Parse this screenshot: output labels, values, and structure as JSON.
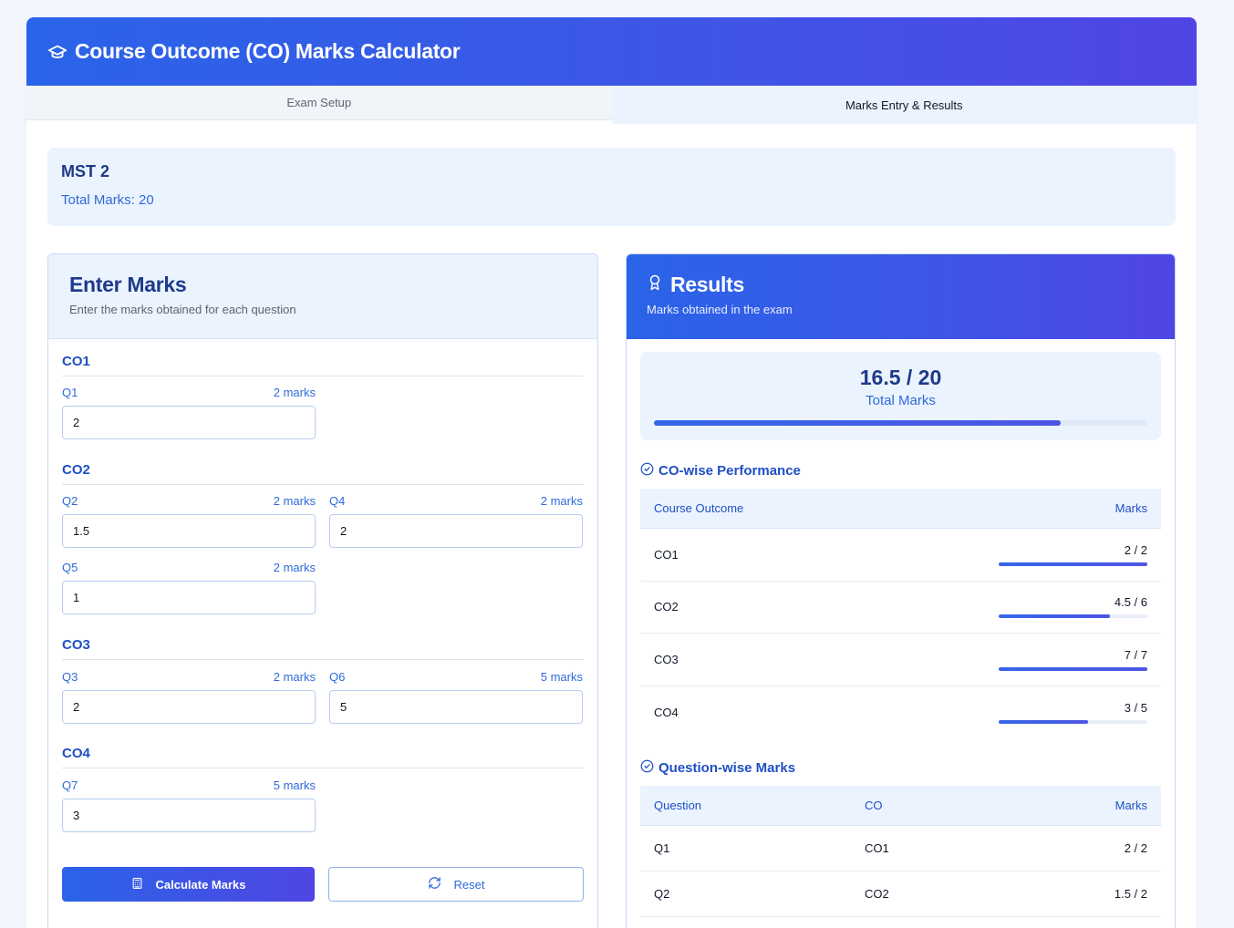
{
  "app": {
    "title": "Course Outcome (CO) Marks Calculator"
  },
  "tabs": [
    {
      "label": "Exam Setup",
      "active": false
    },
    {
      "label": "Marks Entry & Results",
      "active": true
    }
  ],
  "exam": {
    "name": "MST 2",
    "total_label": "Total Marks: 20"
  },
  "entry": {
    "title": "Enter Marks",
    "subtitle": "Enter the marks obtained for each question",
    "groups": [
      {
        "co": "CO1",
        "questions": [
          {
            "q": "Q1",
            "max": "2 marks",
            "value": "2"
          }
        ]
      },
      {
        "co": "CO2",
        "questions": [
          {
            "q": "Q2",
            "max": "2 marks",
            "value": "1.5"
          },
          {
            "q": "Q4",
            "max": "2 marks",
            "value": "2"
          },
          {
            "q": "Q5",
            "max": "2 marks",
            "value": "1"
          }
        ]
      },
      {
        "co": "CO3",
        "questions": [
          {
            "q": "Q3",
            "max": "2 marks",
            "value": "2"
          },
          {
            "q": "Q6",
            "max": "5 marks",
            "value": "5"
          }
        ]
      },
      {
        "co": "CO4",
        "questions": [
          {
            "q": "Q7",
            "max": "5 marks",
            "value": "3"
          }
        ]
      }
    ],
    "calculate_label": "Calculate Marks",
    "reset_label": "Reset"
  },
  "results": {
    "title": "Results",
    "subtitle": "Marks obtained in the exam",
    "score": "16.5 / 20",
    "score_label": "Total Marks",
    "score_fraction": 0.825,
    "co_section_title": "CO-wise Performance",
    "co_headers": {
      "outcome": "Course Outcome",
      "marks": "Marks"
    },
    "co_rows": [
      {
        "co": "CO1",
        "marks": "2 / 2",
        "fraction": 1.0
      },
      {
        "co": "CO2",
        "marks": "4.5 / 6",
        "fraction": 0.75
      },
      {
        "co": "CO3",
        "marks": "7 / 7",
        "fraction": 1.0
      },
      {
        "co": "CO4",
        "marks": "3 / 5",
        "fraction": 0.6
      }
    ],
    "q_section_title": "Question-wise Marks",
    "q_headers": {
      "question": "Question",
      "co": "CO",
      "marks": "Marks"
    },
    "q_rows": [
      {
        "q": "Q1",
        "co": "CO1",
        "marks": "2 / 2"
      },
      {
        "q": "Q2",
        "co": "CO2",
        "marks": "1.5 / 2"
      }
    ]
  },
  "colors": {
    "accent": "#2a64e8",
    "accent_end": "#5045e4",
    "heading": "#1e3a8a",
    "link": "#2f6ad9"
  }
}
